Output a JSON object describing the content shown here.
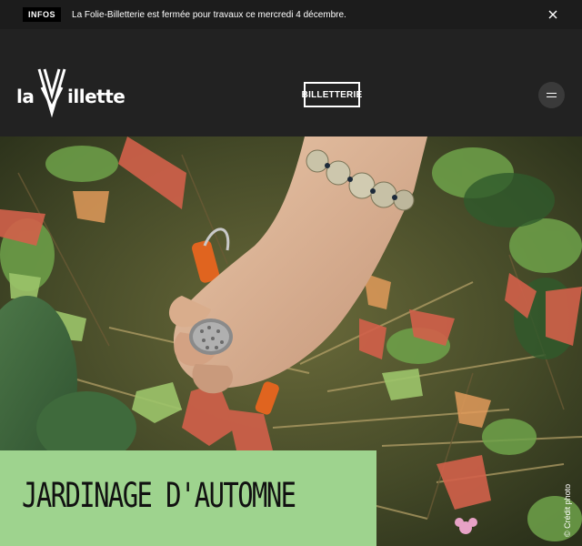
{
  "info_bar": {
    "tag": "INFOS",
    "message": "La Folie-Billetterie est fermée pour travaux ce mercredi 4 décembre."
  },
  "header": {
    "logo_prefix": "la",
    "logo_suffix": "illette",
    "ticket_label": "BILLETTERIE",
    "menu_icon": "hamburger-menu-icon"
  },
  "hero": {
    "title": "JARDINAGE D'AUTOMNE",
    "credit": "© Crédit photo",
    "title_bg": "#9ed38e"
  },
  "colors": {
    "header_bg": "#222222",
    "banner_bg": "#1c1c1c",
    "accent": "#9ed38e"
  }
}
